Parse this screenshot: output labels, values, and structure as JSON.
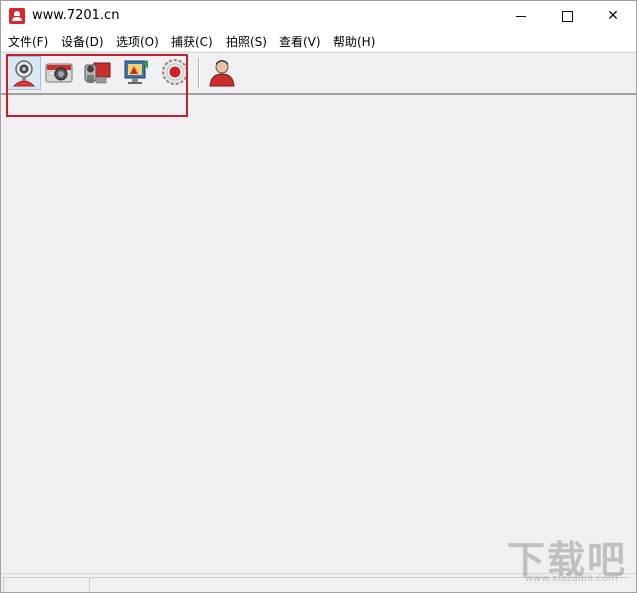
{
  "window": {
    "title": "www.7201.cn",
    "controls": {
      "minimize": "minimize",
      "maximize": "maximize",
      "close": "✕"
    }
  },
  "menu": {
    "items": [
      {
        "label": "文件(F)"
      },
      {
        "label": "设备(D)"
      },
      {
        "label": "选项(O)"
      },
      {
        "label": "捕获(C)"
      },
      {
        "label": "拍照(S)"
      },
      {
        "label": "查看(V)"
      },
      {
        "label": "帮助(H)"
      }
    ]
  },
  "toolbar": {
    "buttons": [
      {
        "icon": "webcam-icon",
        "active": true
      },
      {
        "icon": "camera-icon",
        "active": false
      },
      {
        "icon": "camcorder-icon",
        "active": false
      },
      {
        "icon": "display-settings-icon",
        "active": false
      },
      {
        "icon": "record-icon",
        "active": false
      },
      {
        "icon": "user-icon",
        "active": false
      }
    ]
  },
  "colors": {
    "highlight_box": "#c8202b",
    "accent": "#d9252b",
    "background": "#f0eff1"
  },
  "watermark": {
    "text": "下载吧",
    "url": "www.xiazaiba.com"
  }
}
